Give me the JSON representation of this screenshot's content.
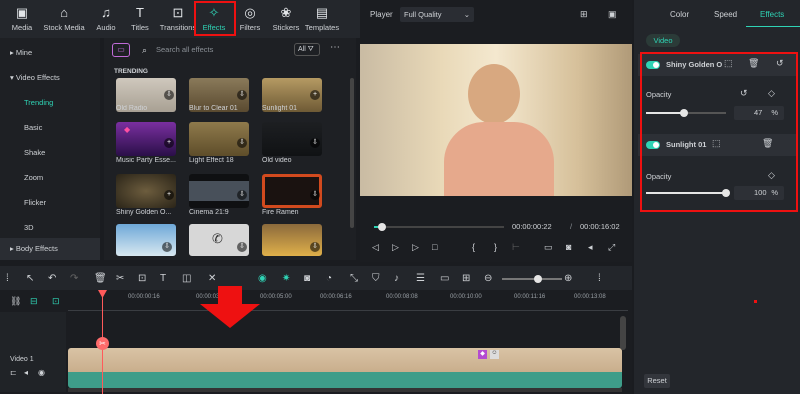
{
  "nav": {
    "items": [
      {
        "label": "Media",
        "icon": "media-icon"
      },
      {
        "label": "Stock Media",
        "icon": "stock-media-icon"
      },
      {
        "label": "Audio",
        "icon": "audio-icon"
      },
      {
        "label": "Titles",
        "icon": "titles-icon"
      },
      {
        "label": "Transitions",
        "icon": "transitions-icon"
      },
      {
        "label": "Effects",
        "icon": "effects-icon"
      },
      {
        "label": "Filters",
        "icon": "filters-icon"
      },
      {
        "label": "Stickers",
        "icon": "stickers-icon"
      },
      {
        "label": "Templates",
        "icon": "templates-icon"
      }
    ],
    "active": "Effects"
  },
  "sidebar": {
    "items": [
      {
        "label": "Mine",
        "arrow": "▸"
      },
      {
        "label": "Video Effects",
        "arrow": "▾"
      },
      {
        "label": "Trending"
      },
      {
        "label": "Basic"
      },
      {
        "label": "Shake"
      },
      {
        "label": "Zoom"
      },
      {
        "label": "Flicker"
      },
      {
        "label": "3D"
      },
      {
        "label": "Body Effects",
        "arrow": "▸"
      }
    ]
  },
  "browser": {
    "search_placeholder": "Search all effects",
    "filter_label": "All",
    "section": "TRENDING",
    "items": [
      {
        "label": "Old Radio"
      },
      {
        "label": "Blur to Clear 01"
      },
      {
        "label": "Sunlight 01"
      },
      {
        "label": "Music Party Esse..."
      },
      {
        "label": "Light Effect 18"
      },
      {
        "label": "Old video"
      },
      {
        "label": "Shiny Golden O..."
      },
      {
        "label": "Cinema 21:9"
      },
      {
        "label": "Fire Ramen"
      },
      {
        "label": ""
      },
      {
        "label": ""
      },
      {
        "label": ""
      }
    ]
  },
  "player": {
    "label": "Player",
    "quality": "Full Quality",
    "time_current": "00:00:00:22",
    "time_total": "00:00:16:02"
  },
  "right_panel": {
    "tabs": [
      "Color",
      "Speed",
      "Effects"
    ],
    "active_tab": "Effects",
    "video_chip": "Video",
    "effects": [
      {
        "name": "Shiny Golden O",
        "opacity_label": "Opacity",
        "opacity": 47,
        "unit": "%"
      },
      {
        "name": "Sunlight 01",
        "opacity_label": "Opacity",
        "opacity": 100,
        "unit": "%"
      }
    ],
    "reset": "Reset"
  },
  "timeline": {
    "ticks": [
      "00:00:00:16",
      "00:00:03:08",
      "00:00:05:00",
      "00:00:06:16",
      "00:00:08:08",
      "00:00:10:00",
      "00:00:11:16",
      "00:00:13:08"
    ],
    "track_label": "Video 1"
  },
  "colors": {
    "accent": "#2fd3b5",
    "highlight": "#e11111",
    "playhead": "#ff5a5a"
  }
}
